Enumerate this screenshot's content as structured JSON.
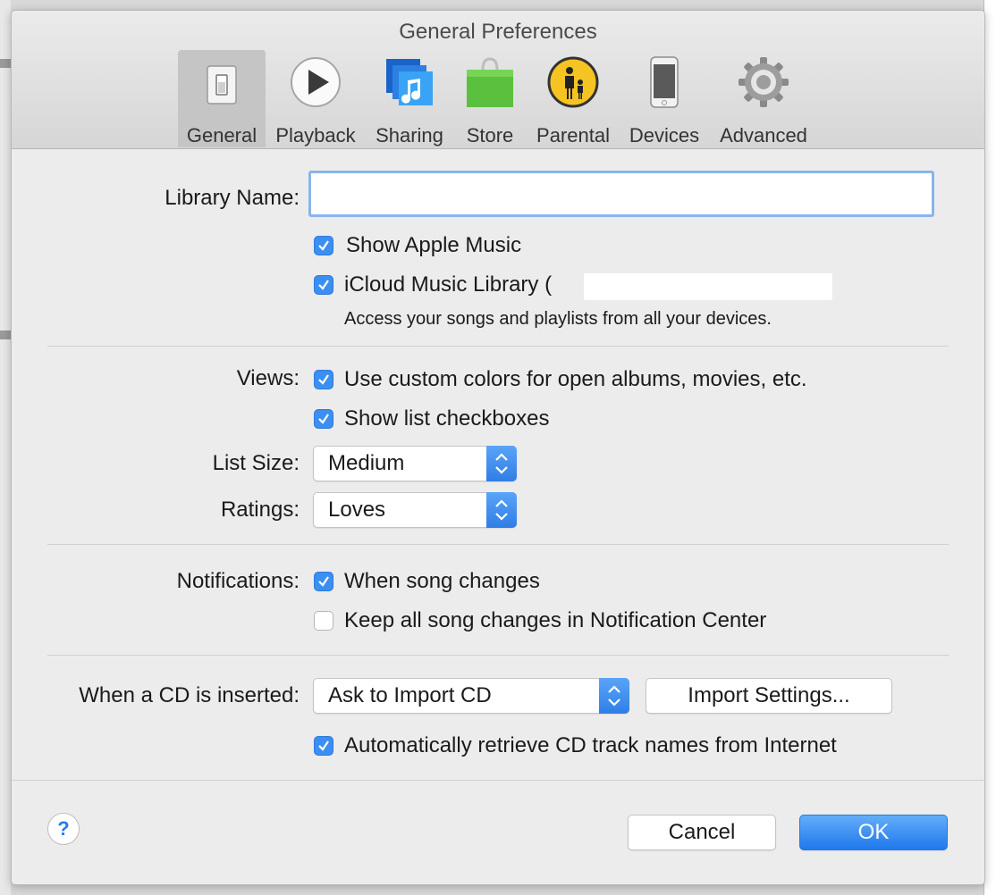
{
  "window": {
    "title": "General Preferences"
  },
  "toolbar": [
    {
      "label": "General",
      "icon": "general-switch-icon",
      "active": true
    },
    {
      "label": "Playback",
      "icon": "play-icon"
    },
    {
      "label": "Sharing",
      "icon": "music-note-icon"
    },
    {
      "label": "Store",
      "icon": "shopping-bag-icon"
    },
    {
      "label": "Parental",
      "icon": "parental-icon"
    },
    {
      "label": "Devices",
      "icon": "iphone-icon"
    },
    {
      "label": "Advanced",
      "icon": "gear-icon"
    }
  ],
  "library": {
    "name_label": "Library Name:",
    "name_value": "",
    "show_apple_music": {
      "label": "Show Apple Music",
      "checked": true
    },
    "icloud_library": {
      "label": "iCloud Music Library (",
      "checked": true
    },
    "icloud_desc": "Access your songs and playlists from all your devices."
  },
  "views": {
    "label": "Views:",
    "custom_colors": {
      "label": "Use custom colors for open albums, movies, etc.",
      "checked": true
    },
    "list_checkboxes": {
      "label": "Show list checkboxes",
      "checked": true
    }
  },
  "list_size": {
    "label": "List Size:",
    "value": "Medium"
  },
  "ratings": {
    "label": "Ratings:",
    "value": "Loves"
  },
  "notifications": {
    "label": "Notifications:",
    "song_changes": {
      "label": "When song changes",
      "checked": true
    },
    "keep_all": {
      "label": "Keep all song changes in Notification Center",
      "checked": false
    }
  },
  "cd": {
    "label": "When a CD is inserted:",
    "value": "Ask to Import CD",
    "import_settings": "Import Settings...",
    "retrieve_names": {
      "label": "Automatically retrieve CD track names from Internet",
      "checked": true
    }
  },
  "footer": {
    "help": "?",
    "cancel": "Cancel",
    "ok": "OK"
  },
  "colors": {
    "accent": "#3b8ff2",
    "dialog_bg": "#ececec"
  }
}
